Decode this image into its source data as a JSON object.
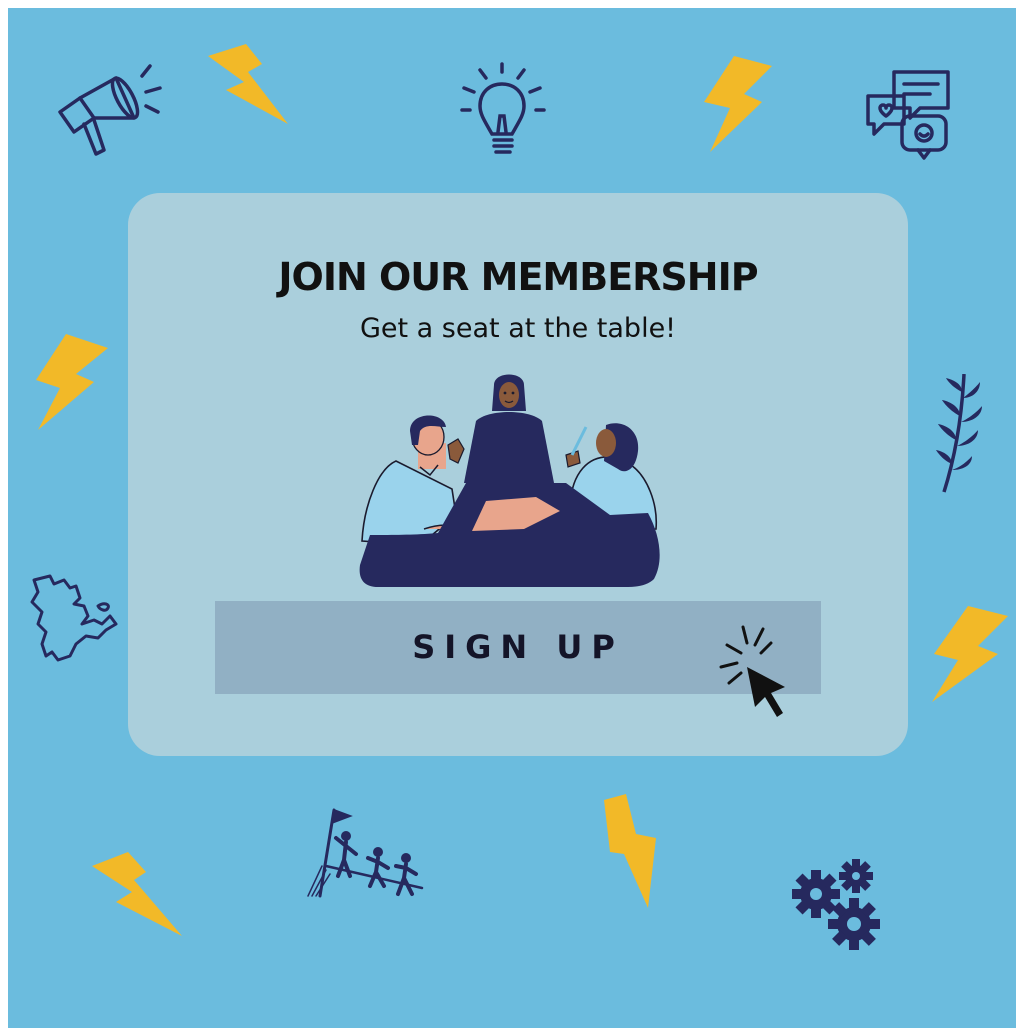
{
  "card": {
    "title": "JOIN OUR MEMBERSHIP",
    "subtitle": "Get a seat at the table!",
    "button_label": "SIGN UP"
  },
  "icons": [
    "megaphone-icon",
    "lightbulb-icon",
    "chat-bubbles-icon",
    "leaf-branch-icon",
    "map-outline-icon",
    "team-climbing-flag-icon",
    "gears-icon",
    "lightning-bolt-icon",
    "cursor-click-icon"
  ],
  "colors": {
    "background": "#6bbcde",
    "card": "#aacfdc",
    "button": "#91b0c4",
    "bolt": "#f2b928",
    "icon_stroke": "#26295e"
  }
}
